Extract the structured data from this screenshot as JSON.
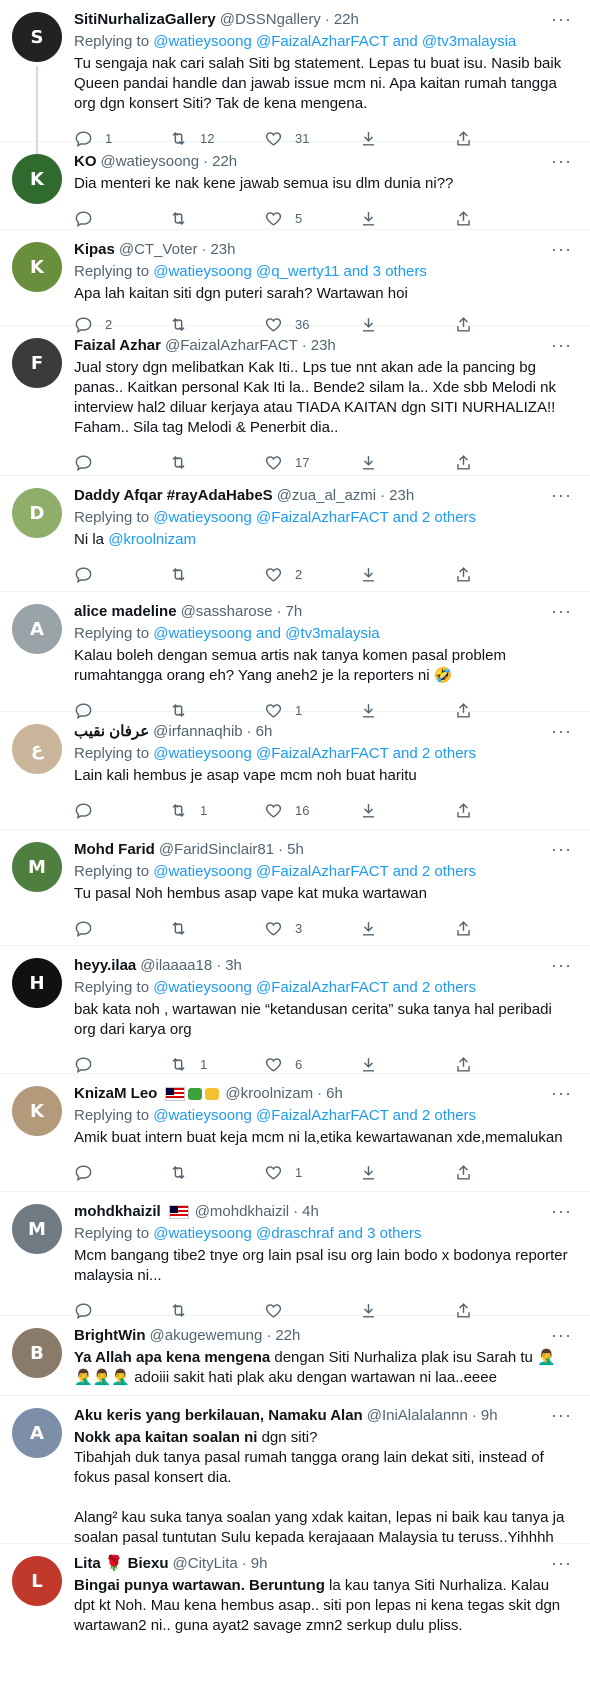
{
  "tweets": [
    {
      "name": "SitiNurhalizaGallery",
      "handle": "@DSSNgallery",
      "time": "22h",
      "replying_prefix": "Replying to ",
      "replying_to": "@watieysoong @FaizalAzharFACT and @tv3malaysia",
      "text": "Tu sengaja nak cari salah Siti bg statement. Lepas tu buat isu. Nasib baik Queen pandai handle dan jawab issue mcm ni. Apa kaitan rumah tangga org dgn konsert Siti? Tak de kena mengena.",
      "reply_count": "1",
      "retweet_count": "12",
      "like_count": "31",
      "avatar_color": "#222222",
      "avatar_initial": "S"
    },
    {
      "name": "KO",
      "handle": "@watieysoong",
      "time": "22h",
      "text": "Dia menteri ke nak kene jawab semua isu dlm dunia ni??",
      "reply_count": "",
      "retweet_count": "",
      "like_count": "5",
      "avatar_color": "#2f6b2f",
      "avatar_initial": "K"
    },
    {
      "name": "Kipas",
      "handle": "@CT_Voter",
      "time": "23h",
      "replying_prefix": "Replying to ",
      "replying_to": "@watieysoong @q_werty11 and 3 others",
      "text": "Apa lah kaitan siti dgn puteri sarah? Wartawan hoi",
      "reply_count": "2",
      "retweet_count": "",
      "like_count": "36",
      "avatar_color": "#6a8f3c",
      "avatar_initial": "K"
    },
    {
      "name": "Faizal Azhar",
      "handle": "@FaizalAzharFACT",
      "time": "23h",
      "text": "Jual story dgn melibatkan Kak Iti.. Lps tue nnt akan ade la pancing bg panas.. Kaitkan personal Kak Iti la.. Bende2 silam la.. Xde sbb Melodi nk interview hal2 diluar kerjaya atau TIADA KAITAN dgn SITI NURHALIZA!! Faham.. Sila tag Melodi & Penerbit dia..",
      "reply_count": "",
      "retweet_count": "",
      "like_count": "17",
      "avatar_color": "#3b3b3b",
      "avatar_initial": "F"
    },
    {
      "name": "Daddy Afqar #rayAdaHabeS",
      "handle": "@zua_al_azmi",
      "time": "23h",
      "replying_prefix": "Replying to ",
      "replying_to": "@watieysoong @FaizalAzharFACT and 2 others",
      "text_prefix": "Ni la ",
      "text_link": "@kroolnizam",
      "reply_count": "",
      "retweet_count": "",
      "like_count": "2",
      "avatar_color": "#8fae6a",
      "avatar_initial": "D"
    },
    {
      "name": "alice madeline",
      "handle": "@sassharose",
      "time": "7h",
      "replying_prefix": "Replying to ",
      "replying_to": "@watieysoong and @tv3malaysia",
      "text": "Kalau boleh dengan semua artis nak tanya komen pasal problem rumahtangga orang eh? Yang aneh2 je la reporters ni 🤣",
      "reply_count": "",
      "retweet_count": "",
      "like_count": "1",
      "avatar_color": "#9aa3a8",
      "avatar_initial": "A"
    },
    {
      "name": "عرفان نقيب",
      "handle": "@irfannaqhib",
      "time": "6h",
      "replying_prefix": "Replying to ",
      "replying_to": "@watieysoong @FaizalAzharFACT and 2 others",
      "text": "Lain kali hembus je asap vape mcm noh buat haritu",
      "reply_count": "",
      "retweet_count": "1",
      "like_count": "16",
      "avatar_color": "#c9b59a",
      "avatar_initial": "ع"
    },
    {
      "name": "Mohd Farid",
      "handle": "@FaridSinclair81",
      "time": "5h",
      "replying_prefix": "Replying to ",
      "replying_to": "@watieysoong @FaizalAzharFACT and 2 others",
      "text": "Tu pasal Noh hembus asap vape kat muka wartawan",
      "reply_count": "",
      "retweet_count": "",
      "like_count": "3",
      "avatar_color": "#4f7f3f",
      "avatar_initial": "M"
    },
    {
      "name": "heyy.ilaa",
      "handle": "@ilaaaa18",
      "time": "3h",
      "replying_prefix": "Replying to ",
      "replying_to": "@watieysoong @FaizalAzharFACT and 2 others",
      "text": "bak kata noh , wartawan nie “ketandusan cerita” suka tanya hal peribadi org dari karya org",
      "reply_count": "",
      "retweet_count": "1",
      "like_count": "6",
      "avatar_color": "#111111",
      "avatar_initial": "H"
    },
    {
      "name": "KnizaM Leo",
      "handle": "@kroolnizam",
      "time": "6h",
      "replying_prefix": "Replying to ",
      "replying_to": "@watieysoong @FaizalAzharFACT and 2 others",
      "text": "Amik buat intern buat keja mcm ni la,etika kewartawanan xde,memalukan",
      "reply_count": "",
      "retweet_count": "",
      "like_count": "1",
      "avatar_color": "#b39a7a",
      "avatar_initial": "K"
    },
    {
      "name": "mohdkhaizil",
      "handle": "@mohdkhaizil",
      "time": "4h",
      "replying_prefix": "Replying to ",
      "replying_to": "@watieysoong @draschraf and 3 others",
      "text": "Mcm bangang tibe2 tnye org lain psal isu org lain bodo x bodonya reporter malaysia ni...",
      "reply_count": "",
      "retweet_count": "",
      "like_count": "",
      "avatar_color": "#6f7a82",
      "avatar_initial": "M"
    },
    {
      "name": "BrightWin",
      "handle": "@akugewemung",
      "time": "22h",
      "text_bold": "Ya Allah apa kena mengena",
      "text_rest": " dengan Siti Nurhaliza plak isu Sarah tu 🤦‍♂️🤦‍♂️🤦‍♂️🤦‍♂️ adoiii sakit hati plak aku dengan wartawan ni laa..eeee",
      "avatar_color": "#8a7a6a",
      "avatar_initial": "B"
    },
    {
      "name": "Aku keris yang berkilauan, Namaku Alan",
      "handle": "@IniAlalalannn",
      "time": "9h",
      "text_bold": "Nokk apa kaitan soalan ni",
      "text_rest": " dgn siti?\nTibahjah duk tanya pasal rumah tangga orang lain dekat siti, instead of fokus pasal konsert dia.\n\nAlang² kau suka tanya soalan yang xdak kaitan, lepas ni baik kau tanya ja soalan pasal tuntutan Sulu kepada kerajaaan Malaysia tu teruss..Yihhhh",
      "avatar_color": "#7d8fa8",
      "avatar_initial": "A"
    },
    {
      "name": "Lita 🌹 Biexu",
      "handle": "@CityLita",
      "time": "9h",
      "text_bold": "Bingai punya wartawan. Beruntung",
      "text_rest": " la kau tanya Siti Nurhaliza. Kalau dpt kt Noh. Mau kena hembus asap.. siti pon lepas ni kena tegas skit dgn wartawan2 ni.. guna ayat2 savage zmn2 serkup dulu pliss.",
      "avatar_color": "#c0392b",
      "avatar_initial": "L"
    }
  ]
}
